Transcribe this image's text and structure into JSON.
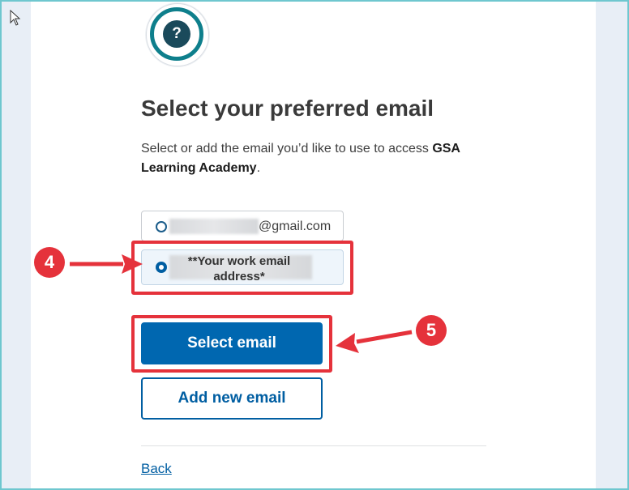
{
  "page": {
    "title": "Select your preferred email",
    "description_prefix": "Select or add the email you’d like to use to access ",
    "description_app": "GSA Learning Academy",
    "description_suffix": "."
  },
  "options": [
    {
      "label": "@gmail.com",
      "selected": false
    },
    {
      "label": "**Your work email address*",
      "selected": true
    }
  ],
  "buttons": {
    "select_email": "Select email",
    "add_new_email": "Add new email"
  },
  "links": {
    "back": "Back"
  },
  "annotations": {
    "step4": "4",
    "step5": "5"
  },
  "colors": {
    "primary": "#0067b0",
    "highlight": "#e5323b",
    "accent_teal": "#0e7f8c"
  },
  "icons": {
    "question": "?"
  }
}
